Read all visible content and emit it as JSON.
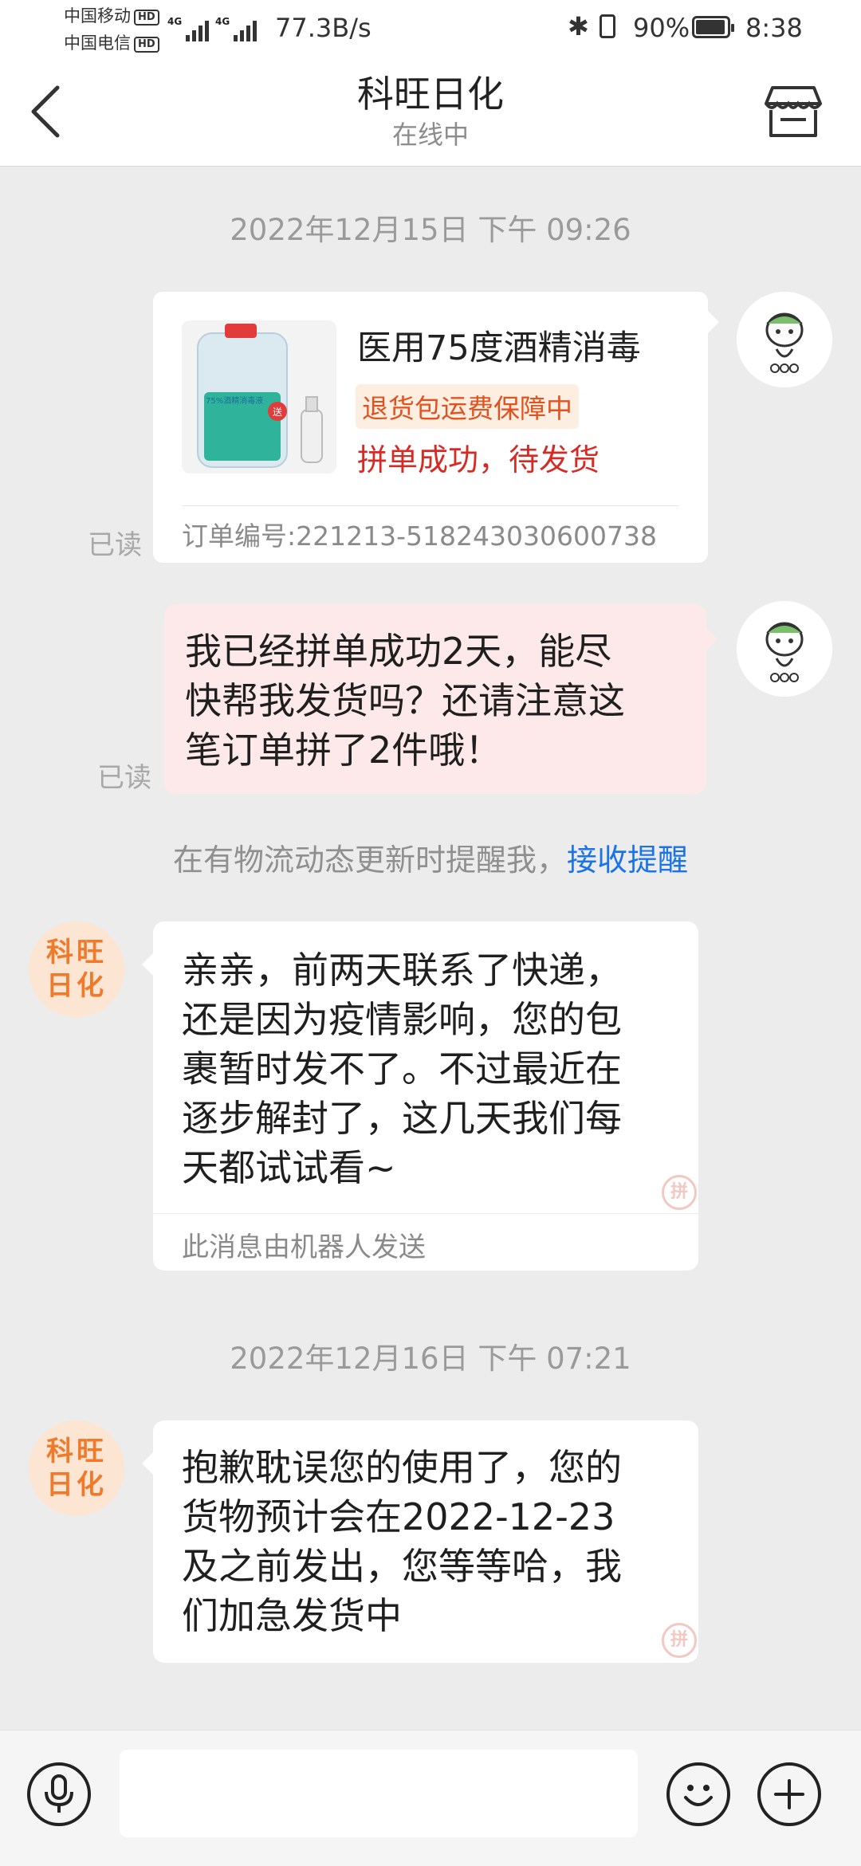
{
  "status_bar": {
    "carrier_1": "中国移动",
    "carrier_2": "中国电信",
    "hd_badge": "HD",
    "network_1": "4G",
    "network_2": "4G",
    "net_speed": "77.3B/s",
    "battery": "90%",
    "battery_level": 0.9,
    "time": "8:38"
  },
  "header": {
    "title": "科旺日化",
    "subtitle": "在线中",
    "back_icon": "chevron-left-icon",
    "store_icon": "store-icon"
  },
  "chat": {
    "timestamp_1": "2022年12月15日 下午 09:26",
    "order_card": {
      "product_name": "医用75度酒精消毒",
      "tag": "退货包运费保障中",
      "status": "拼单成功，待发货",
      "order_number": "订单编号:221213-518243030600738",
      "read_label": "已读",
      "image_label_top": "75%酒精消毒液",
      "image_label_gift": "送"
    },
    "user_message": {
      "lines": [
        "我已经拼单成功2天，能尽",
        "快帮我发货吗？还请注意这",
        "笔订单拼了2件哦！"
      ],
      "read_label": "已读"
    },
    "system_notice": {
      "text": "在有物流动态更新时提醒我，",
      "link": "接收提醒"
    },
    "shop_reply_1": {
      "lines": [
        "亲亲，前两天联系了快递，",
        "还是因为疫情影响，您的包",
        "裹暂时发不了。不过最近在",
        "逐步解封了，这几天我们每",
        "天都试试看~"
      ],
      "bot_note": "此消息由机器人发送"
    },
    "timestamp_2": "2022年12月16日 下午 07:21",
    "shop_reply_2": {
      "lines": [
        "抱歉耽误您的使用了，您的",
        "货物预计会在2022-12-23",
        "及之前发出，您等等哈，我",
        "们加急发货中"
      ]
    },
    "shop_avatar_text": [
      "科旺",
      "日化"
    ],
    "stamp_text": "拼"
  },
  "input_bar": {
    "voice_icon": "microphone-icon",
    "emoji_icon": "emoji-icon",
    "plus_icon": "plus-icon",
    "placeholder": ""
  },
  "colors": {
    "background": "#ececec",
    "my_bubble": "#fde9e9",
    "link": "#1a73e8",
    "status_red": "#d62a24",
    "tag_orange": "#e0531f",
    "shop_orange": "#f07a2a"
  }
}
